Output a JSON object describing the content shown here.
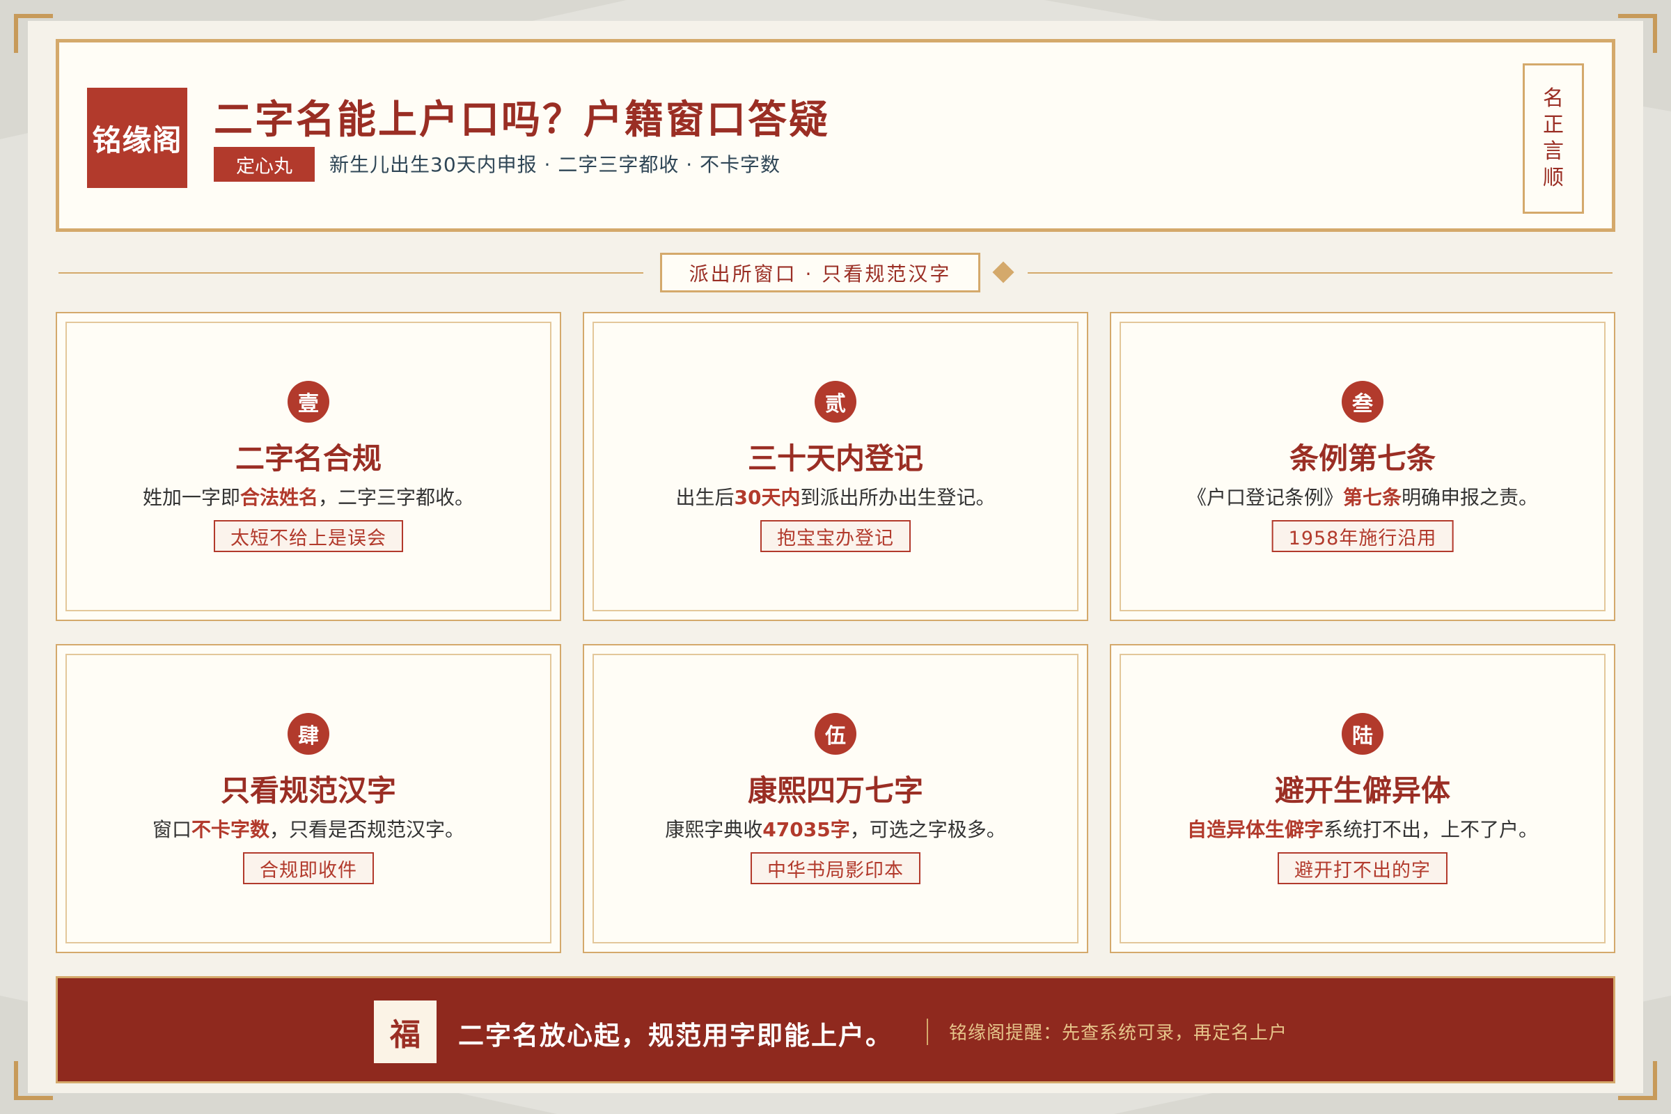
{
  "header": {
    "logo": "铭缘阁",
    "title": "二字名能上户口吗？户籍窗口答疑",
    "tag": "定心丸",
    "subtitle": "新生儿出生30天内申报 · 二字三字都收 · 不卡字数",
    "seal": [
      "名",
      "正",
      "言",
      "顺"
    ]
  },
  "divider": {
    "label": "派出所窗口 · 只看规范汉字"
  },
  "cards": [
    {
      "badge": "壹",
      "title": "二字名合规",
      "desc": [
        "姓加一字即",
        "合法姓名",
        "，二字三字都收。"
      ],
      "tag": "太短不给上是误会"
    },
    {
      "badge": "贰",
      "title": "三十天内登记",
      "desc": [
        "出生后",
        "30天内",
        "到派出所办出生登记。"
      ],
      "tag": "抱宝宝办登记"
    },
    {
      "badge": "叁",
      "title": "条例第七条",
      "desc": [
        "《户口登记条例》",
        "第七条",
        "明确申报之责。"
      ],
      "tag": "1958年施行沿用"
    },
    {
      "badge": "肆",
      "title": "只看规范汉字",
      "desc": [
        "窗口",
        "不卡字数",
        "，只看是否规范汉字。"
      ],
      "tag": "合规即收件"
    },
    {
      "badge": "伍",
      "title": "康熙四万七字",
      "desc": [
        "康熙字典收",
        "47035字",
        "，可选之字极多。"
      ],
      "tag": "中华书局影印本"
    },
    {
      "badge": "陆",
      "title": "避开生僻异体",
      "desc": [
        "",
        "自造异体生僻字",
        "系统打不出，上不了户。"
      ],
      "tag": "避开打不出的字"
    }
  ],
  "footer": {
    "emblem": "福",
    "main": "二字名放心起，规范用字即能上户。",
    "note": "铭缘阁提醒：先查系统可录，再定名上户"
  },
  "colors": {
    "primary_red": "#b23a2c",
    "dark_red": "#8f291e",
    "gold": "#d4a96b",
    "paper": "#fffdf6"
  }
}
